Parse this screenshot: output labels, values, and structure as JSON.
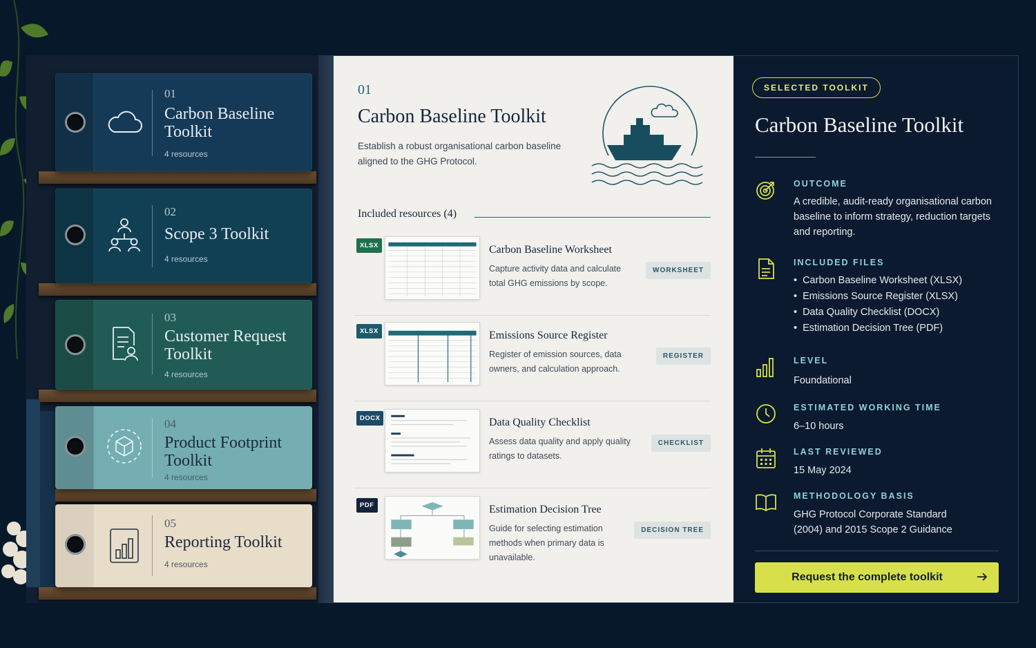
{
  "binders": [
    {
      "num": "01",
      "title": "Carbon Baseline Toolkit",
      "resources": "4 resources",
      "icon": "cloud-icon",
      "color": "#153a57"
    },
    {
      "num": "02",
      "title": "Scope 3 Toolkit",
      "resources": "4 resources",
      "icon": "people-network-icon",
      "color": "#114055"
    },
    {
      "num": "03",
      "title": "Customer Request Toolkit",
      "resources": "4 resources",
      "icon": "document-user-icon",
      "color": "#205c55"
    },
    {
      "num": "04",
      "title": "Product Footprint Toolkit",
      "resources": "4 resources",
      "icon": "cube-cycle-icon",
      "color": "#74aeb3"
    },
    {
      "num": "05",
      "title": "Reporting Toolkit",
      "resources": "4 resources",
      "icon": "bar-chart-report-icon",
      "color": "#e8ddc9"
    }
  ],
  "detail": {
    "num": "01",
    "title": "Carbon Baseline Toolkit",
    "description": "Establish a robust organisational carbon baseline aligned to the GHG Protocol.",
    "resources_heading": "Included resources (4)",
    "resources": [
      {
        "format": "XLSX",
        "format_color": "#1f6f4f",
        "title": "Carbon Baseline Worksheet",
        "description": "Capture activity data and calculate total GHG emissions by scope.",
        "badge": "WORKSHEET"
      },
      {
        "format": "XLSX",
        "format_color": "#1d5a6b",
        "title": "Emissions Source Register",
        "description": "Register of emission sources, data owners, and calculation approach.",
        "badge": "REGISTER"
      },
      {
        "format": "DOCX",
        "format_color": "#1d4a66",
        "title": "Data Quality Checklist",
        "description": "Assess data quality and apply quality ratings to datasets.",
        "badge": "CHECKLIST"
      },
      {
        "format": "PDF",
        "format_color": "#13243a",
        "title": "Estimation Decision Tree",
        "description": "Guide for selecting estimation methods when primary data is unavailable.",
        "badge": "DECISION TREE"
      }
    ]
  },
  "sidebar": {
    "pill": "SELECTED TOOLKIT",
    "title": "Carbon Baseline Toolkit",
    "outcome_label": "OUTCOME",
    "outcome": "A credible, audit-ready organisational carbon baseline to inform strategy, reduction targets and reporting.",
    "files_label": "INCLUDED FILES",
    "files": [
      "Carbon Baseline Worksheet (XLSX)",
      "Emissions Source Register (XLSX)",
      "Data Quality Checklist (DOCX)",
      "Estimation Decision Tree (PDF)"
    ],
    "level_label": "LEVEL",
    "level": "Foundational",
    "time_label": "ESTIMATED WORKING TIME",
    "time": "6–10 hours",
    "reviewed_label": "LAST REVIEWED",
    "reviewed": "15 May 2024",
    "method_label": "METHODOLOGY BASIS",
    "method": "GHG Protocol Corporate Standard (2004) and 2015 Scope 2 Guidance",
    "cta": "Request the complete toolkit"
  },
  "colors": {
    "accent": "#d7e04a",
    "teal": "#1f6a78",
    "panel": "#0b1a2e"
  }
}
